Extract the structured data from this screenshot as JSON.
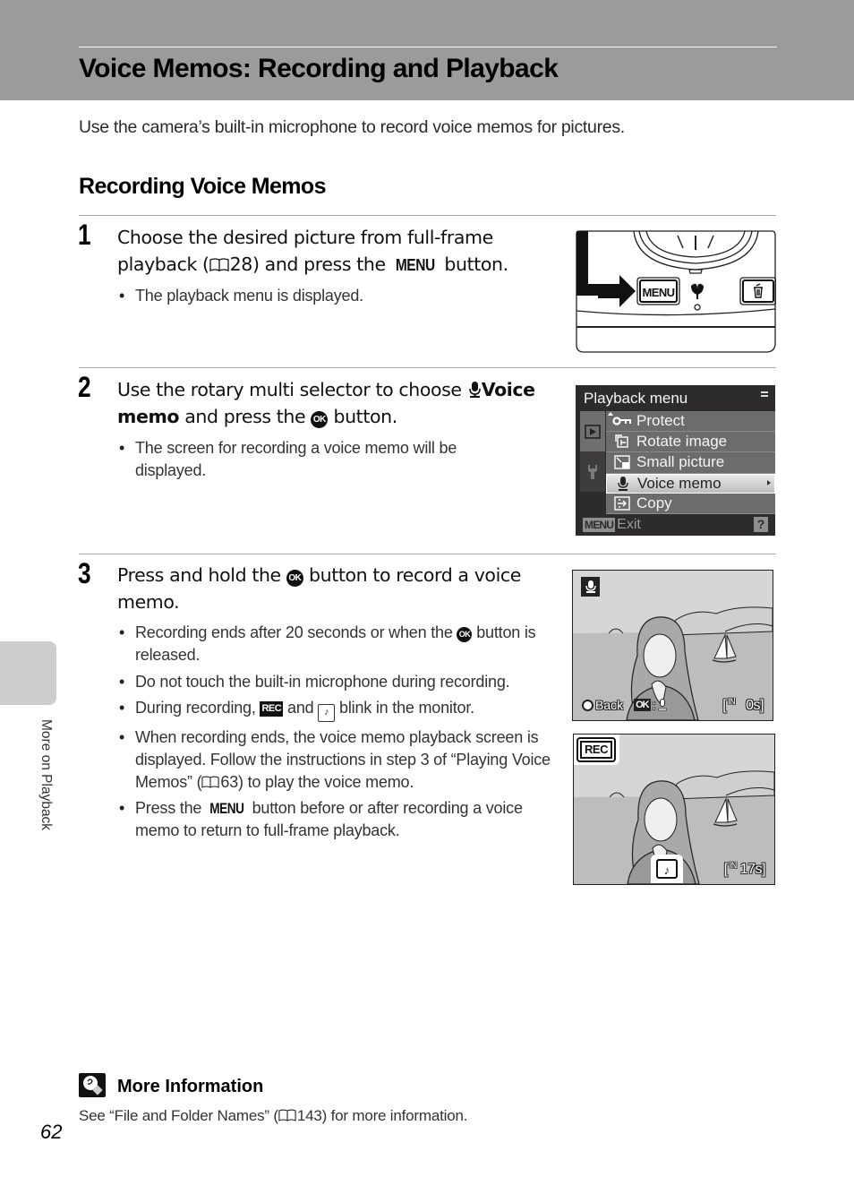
{
  "header": {
    "title": "Voice Memos: Recording and Playback",
    "intro": "Use the camera’s built-in microphone to record voice memos for pictures."
  },
  "section": {
    "title": "Recording Voice Memos"
  },
  "side_tab": {
    "label": "More on Playback"
  },
  "steps": [
    {
      "number": "1",
      "title_parts": {
        "a": "Choose the desired picture from full-frame playback (",
        "ref": "28",
        "b": ") and press the ",
        "menu": "MENU",
        "c": " button."
      },
      "bullets": [
        "The playback menu is displayed."
      ]
    },
    {
      "number": "2",
      "title_parts": {
        "a": "Use the rotary multi selector to choose ",
        "bold": "Voice memo",
        "b": " and press the ",
        "ok": "OK",
        "c": " button."
      },
      "bullets": [
        "The screen for recording a voice memo will be displayed."
      ]
    },
    {
      "number": "3",
      "title_parts": {
        "a": "Press and hold the ",
        "ok": "OK",
        "b": " button to record a voice memo."
      },
      "bullets": [
        {
          "a": "Recording ends after 20 seconds or when the ",
          "ok": "OK",
          "b": " button is released."
        },
        {
          "a": "Do not touch the built-in microphone during recording."
        },
        {
          "a": "During recording, ",
          "rec": "REC",
          "b": " and ",
          "memo": "♪",
          "c": " blink in the monitor."
        },
        {
          "a": "When recording ends, the voice memo playback screen is displayed. Follow the instructions in step 3 of “Playing Voice Memos” (",
          "ref": "63",
          "b": ") to play the voice memo."
        },
        {
          "a": "Press the ",
          "menu": "MENU",
          "b": " button before or after recording a voice memo to return to full-frame playback."
        }
      ]
    }
  ],
  "figures": {
    "camera": {
      "menu_button_label": "MENU",
      "icons": [
        "arrow-right-icon",
        "menu-button",
        "macro-flower-icon",
        "led-indicator",
        "trash-button"
      ]
    },
    "playback_menu": {
      "title": "Playback menu",
      "items": [
        {
          "icon": "key-protect-icon",
          "label": "Protect",
          "selected": false
        },
        {
          "icon": "rotate-image-icon",
          "label": "Rotate image",
          "selected": false
        },
        {
          "icon": "small-picture-icon",
          "label": "Small picture",
          "selected": false
        },
        {
          "icon": "microphone-icon",
          "label": "Voice memo",
          "selected": true
        },
        {
          "icon": "copy-icon",
          "label": "Copy",
          "selected": false
        }
      ],
      "footer_key": "MENU",
      "footer_label": "Exit",
      "help_label": "?"
    },
    "record_screen": {
      "back_label": "Back",
      "ok_label": "OK",
      "memory_label": "IN",
      "time": "0s"
    },
    "recording_screen": {
      "rec_label": "REC",
      "memo_symbol": "♪",
      "memory_label": "IN",
      "time": "17s"
    }
  },
  "more_info": {
    "title": "More Information",
    "text_a": "See “File and Folder Names” (",
    "ref": "143",
    "text_b": ") for more information."
  },
  "page_number": "62",
  "colors": {
    "header_band": "#9b9b9b",
    "side_tab": "#cdcdcd",
    "menu_bg": "#2e2b2c",
    "menu_item": "#6c6c6c"
  }
}
